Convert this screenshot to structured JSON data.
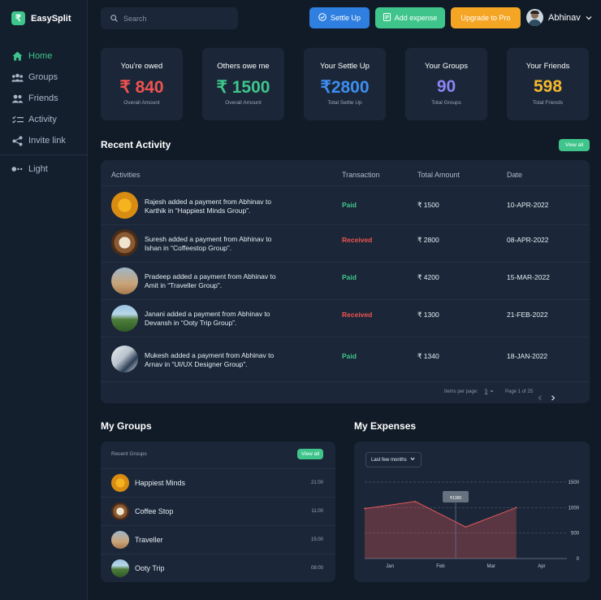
{
  "app": {
    "name": "EasySplit",
    "logo_symbol": "₹"
  },
  "sidebar": {
    "items": [
      {
        "label": "Home",
        "icon": "home-icon",
        "active": true
      },
      {
        "label": "Groups",
        "icon": "groups-icon",
        "active": false
      },
      {
        "label": "Friends",
        "icon": "friends-icon",
        "active": false
      },
      {
        "label": "Activity",
        "icon": "activity-icon",
        "active": false
      },
      {
        "label": "Invite link",
        "icon": "share-icon",
        "active": false
      }
    ],
    "theme_toggle": {
      "label": "Light",
      "icon": "toggle-icon"
    }
  },
  "header": {
    "search_placeholder": "Search",
    "buttons": {
      "settle_up": "Settle Up",
      "add_expense": "Add expense",
      "upgrade": "Upgrade to Pro"
    },
    "user_name": "Abhinav"
  },
  "stats": [
    {
      "title": "You're owed",
      "value": "₹ 840",
      "subtitle": "Overall Amount",
      "color": "#ef5350"
    },
    {
      "title": "Others owe me",
      "value": "₹ 1500",
      "subtitle": "Overall Amount",
      "color": "#3fc58b"
    },
    {
      "title": "Your Settle Up",
      "value": "₹2800",
      "subtitle": "Total Settle Up",
      "color": "#3d8ef0"
    },
    {
      "title": "Your Groups",
      "value": "90",
      "subtitle": "Total Groups",
      "color": "#8c84f5"
    },
    {
      "title": "Your Friends",
      "value": "598",
      "subtitle": "Total Friends",
      "color": "#f5b82e"
    }
  ],
  "recent_activity": {
    "title": "Recent Activity",
    "view_all": "View all",
    "columns": [
      "Activities",
      "Transaction",
      "Total Amount",
      "Date"
    ],
    "rows": [
      {
        "line1": "Rajesh added a payment from Abhinav to",
        "line2": "Karthik in “Happiest Minds Group”.",
        "status": "Paid",
        "amount": "₹ 1500",
        "date": "10-APR-2022",
        "thumb": "emoji"
      },
      {
        "line1": "Suresh added a payment from Abhinav to",
        "line2": "Ishan in “Coffeestop Group”.",
        "status": "Received",
        "amount": "₹ 2800",
        "date": "08-APR-2022",
        "thumb": "coffee"
      },
      {
        "line1": "Pradeep added a payment from Abhinav to",
        "line2": "Amit in “Traveller Group”.",
        "status": "Paid",
        "amount": "₹ 4200",
        "date": "15-MAR-2022",
        "thumb": "balloon"
      },
      {
        "line1": "Janani added a payment from Abhinav to",
        "line2": "Devansh in “Ooty Trip Group”.",
        "status": "Received",
        "amount": "₹ 1300",
        "date": "21-FEB-2022",
        "thumb": "hills"
      },
      {
        "line1": "Mukesh added a payment from Abhinav to",
        "line2": "Arnav in “UI/UX Designer Group”.",
        "status": "Paid",
        "amount": "₹ 1340",
        "date": "18-JAN-2022",
        "thumb": "office"
      }
    ],
    "status_colors": {
      "Paid": "#3fc58b",
      "Received": "#ef5350"
    },
    "pagination": {
      "items_label": "Items per page:",
      "items_value": "5",
      "page_label": "Page 1 of 25"
    }
  },
  "my_groups": {
    "title": "My Groups",
    "subtitle": "Recent Groups",
    "view_all": "View all",
    "groups": [
      {
        "name": "Happiest Minds",
        "time": "21:00",
        "thumb": "emoji"
      },
      {
        "name": "Coffee Stop",
        "time": "11:00",
        "thumb": "coffee"
      },
      {
        "name": "Traveller",
        "time": "15:00",
        "thumb": "balloon"
      },
      {
        "name": "Ooty Trip",
        "time": "08:00",
        "thumb": "hills"
      }
    ]
  },
  "my_expenses": {
    "title": "My Expenses",
    "filter": "Last few months"
  },
  "chart_data": {
    "type": "area",
    "categories": [
      "Jan",
      "Feb",
      "Mar",
      "Apr"
    ],
    "x_points": [
      0,
      1,
      2,
      3
    ],
    "values": [
      980,
      1120,
      620,
      1000
    ],
    "ylim": [
      0,
      1500
    ],
    "yticks": [
      0,
      500,
      1000,
      1500
    ],
    "grid": true,
    "tooltip": {
      "label": "₹1300"
    },
    "color": "#e0565b"
  }
}
